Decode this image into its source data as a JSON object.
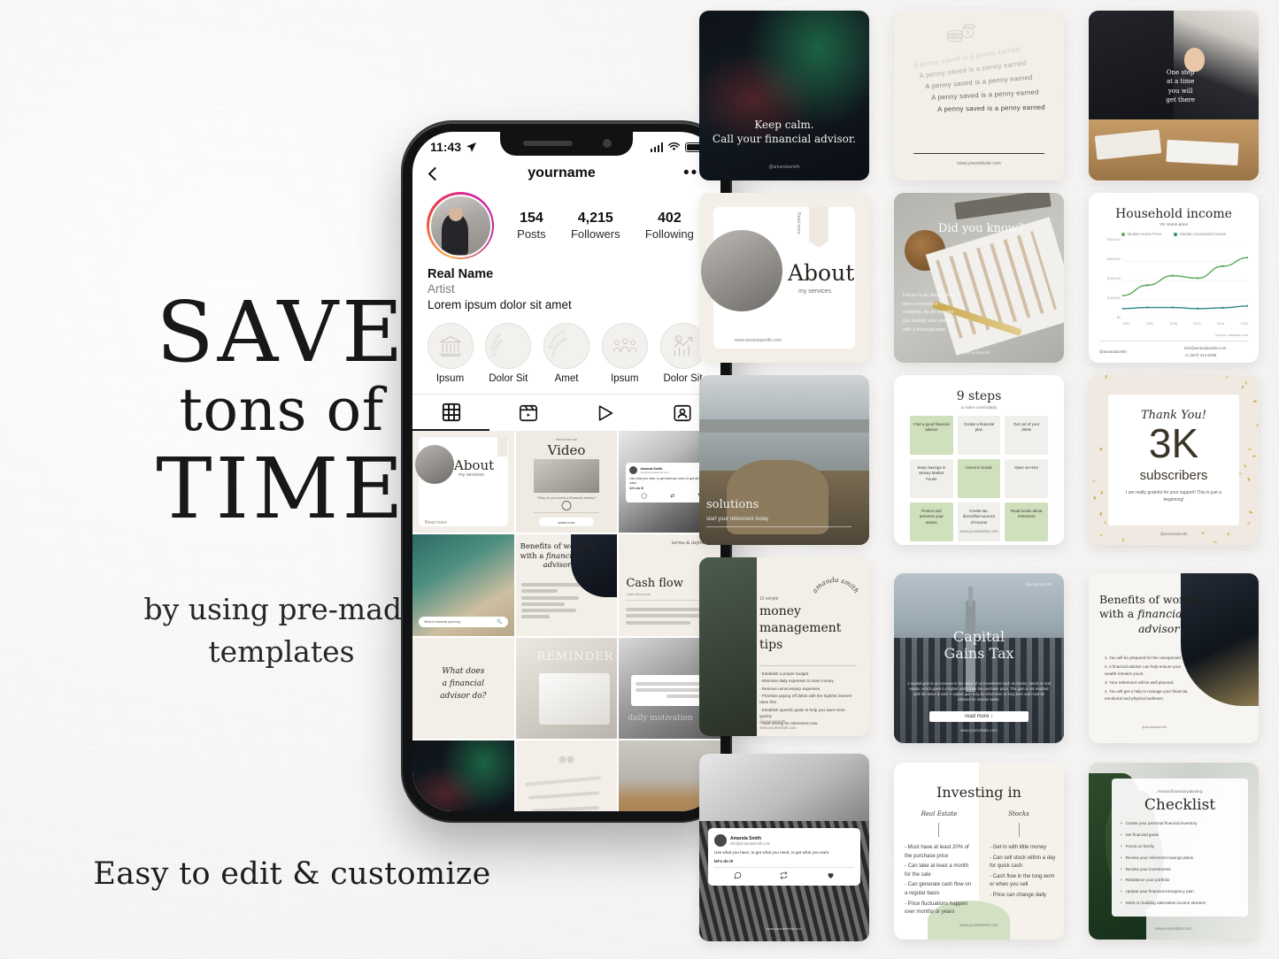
{
  "promo": {
    "headline_1": "SAVE",
    "headline_2": "tons of",
    "headline_3": "TIME",
    "subline": "by using pre-made templates",
    "footer_line": "Easy to edit & customize"
  },
  "phone": {
    "status": {
      "time": "11:43",
      "location_icon": "location-arrow-icon",
      "signal_icon": "cellular-signal-icon",
      "wifi_icon": "wifi-icon",
      "battery_icon": "battery-icon"
    },
    "header": {
      "back_icon": "chevron-left-icon",
      "username": "yourname",
      "more_icon": "ellipsis-icon"
    },
    "stats": [
      {
        "value": "154",
        "label": "Posts"
      },
      {
        "value": "4,215",
        "label": "Followers"
      },
      {
        "value": "402",
        "label": "Following"
      }
    ],
    "bio": {
      "real_name": "Real Name",
      "category": "Artist",
      "text": "Lorem ipsum dolor sit amet"
    },
    "highlights": [
      {
        "label": "Ipsum",
        "icon": "bank-building-icon",
        "arc_text": ""
      },
      {
        "label": "Dolor Sit",
        "icon": "arc-text-icon",
        "arc_text": "Crypto"
      },
      {
        "label": "Amet",
        "icon": "arc-text-icon",
        "arc_text": "financial freedom"
      },
      {
        "label": "Ipsum",
        "icon": "people-group-icon",
        "arc_text": ""
      },
      {
        "label": "Dolor Sit",
        "icon": "growth-chart-icon",
        "arc_text": ""
      }
    ],
    "tabs": [
      {
        "name": "grid",
        "icon": "grid-icon",
        "active": true
      },
      {
        "name": "reels",
        "icon": "reels-icon",
        "active": false
      },
      {
        "name": "video",
        "icon": "play-icon",
        "active": false
      },
      {
        "name": "tagged",
        "icon": "tagged-person-icon",
        "active": false
      }
    ],
    "grid_posts": [
      {
        "id": "p1",
        "kind": "about",
        "title": "About",
        "subtitle": "my services",
        "tag": "Read more"
      },
      {
        "id": "p2",
        "kind": "video",
        "eyebrow": "New from the",
        "title": "Video",
        "caption": "\"Why do you need a financial advisor\"",
        "button": "watch now"
      },
      {
        "id": "p3",
        "kind": "quote-card",
        "author": "Amanda Smith",
        "email": "info@amandasmith.com",
        "quote": "Use what you have, to get what you need, to get what you want.",
        "handle": "let's do it!"
      },
      {
        "id": "p4",
        "kind": "money-photo",
        "search_text": "What is financial planning"
      },
      {
        "id": "p5",
        "kind": "benefits",
        "title_1": "Benefits of working",
        "title_2": "with a",
        "title_3": "financial",
        "title_4": "advisor"
      },
      {
        "id": "p6",
        "kind": "cashflow",
        "eyebrow": "terms & definitions",
        "title": "Cash flow",
        "subtitle": "cash flow noun"
      },
      {
        "id": "p7",
        "kind": "question",
        "line_1": "What does",
        "line_2": "a financial",
        "line_3": "advisor do?"
      },
      {
        "id": "p8",
        "kind": "laptop-photo",
        "overlay": "REMINDER"
      },
      {
        "id": "p9",
        "kind": "quote-photo",
        "footer": "daily motivation"
      },
      {
        "id": "p10",
        "kind": "trading-photo"
      },
      {
        "id": "p11",
        "kind": "penny-swirl"
      },
      {
        "id": "p12",
        "kind": "meeting-photo"
      }
    ]
  },
  "templates": [
    {
      "id": "t1",
      "name": "keep-calm-trading-card",
      "line_1": "Keep calm.",
      "line_2": "Call your financial advisor.",
      "watermark": "@amandasmith"
    },
    {
      "id": "t2",
      "name": "penny-saved-card",
      "repeated_quote": "A penny saved is a penny earned",
      "repeat_count": 5,
      "icon": "coins-stack-icon",
      "website": "www.yourwebsite.com"
    },
    {
      "id": "t3",
      "name": "advisor-meeting-photo-card",
      "overlay_text": "One step at a time you will get there"
    },
    {
      "id": "t4",
      "name": "about-my-services-card",
      "title": "About",
      "subtitle": "my services",
      "side_tab": "Read more",
      "website": "www.amandasmith.com"
    },
    {
      "id": "t5",
      "name": "did-you-know-card",
      "title": "Did you know?",
      "body": "Future is an illusion that does not exist in certainty. As an investor you design your present with a financial plan.",
      "watermark": "@amandasmith"
    },
    {
      "id": "t6",
      "name": "household-income-chart-card",
      "title": "Household income",
      "subtitle": "VS Home price",
      "source_note": "Source: website.com",
      "footer_handle": "@amandasmith",
      "footer_email": "info@amandasmith.com",
      "footer_phone": "+1 (547) 314-8488",
      "chart_data": {
        "type": "line",
        "title": "Household income",
        "subtitle": "VS Home price",
        "xlabel": "",
        "ylabel": "",
        "x": [
          "1992",
          "2000",
          "2008",
          "2012",
          "2018",
          "2020"
        ],
        "ylim": [
          0,
          400000
        ],
        "yticks": [
          "$0",
          "$100,000",
          "$200,000",
          "$300,000",
          "$400,000"
        ],
        "grid": true,
        "legend_position": "top",
        "series": [
          {
            "name": "Median Home Price",
            "color": "#5aa85a",
            "values": [
              120000,
              175000,
              225000,
              212000,
              275000,
              320000
            ]
          },
          {
            "name": "Median Household Income",
            "color": "#2b8a7e",
            "values": [
              52000,
              58000,
              58000,
              52000,
              56000,
              66000
            ]
          }
        ]
      }
    },
    {
      "id": "t7",
      "name": "retirement-bridge-photo-card",
      "title": "solutions",
      "subtitle": "start your retirement today"
    },
    {
      "id": "t8",
      "name": "nine-steps-card",
      "title": "9 steps",
      "subtitle": "to retire comfortably",
      "website": "www.yourwebsite.com",
      "steps": [
        {
          "text": "Find a good financial adviser",
          "highlight": true
        },
        {
          "text": "Create a financial plan",
          "highlight": false
        },
        {
          "text": "Get out of your debts",
          "highlight": false
        },
        {
          "text": "Keep Savings in Money Market Funds",
          "highlight": false
        },
        {
          "text": "Invest in bonds",
          "highlight": true
        },
        {
          "text": "Open an HSA",
          "highlight": false
        },
        {
          "text": "Protect and preserve your assets",
          "highlight": true
        },
        {
          "text": "Create tax-diversified sources of income",
          "highlight": false
        },
        {
          "text": "Read books about retirement",
          "highlight": true
        }
      ]
    },
    {
      "id": "t9",
      "name": "thank-you-subscribers-card",
      "eyebrow": "Thank You!",
      "count": "3K",
      "count_label": "subscribers",
      "body": "I am really grateful for your support! This is just a beginning!",
      "watermark": "@amandasmith",
      "accent_color": "#c9a227"
    },
    {
      "id": "t10",
      "name": "money-management-tips-card",
      "eyebrow": "10 simple",
      "title_1": "money",
      "title_2": "management",
      "title_3": "tips",
      "arc_text": "amanda smith",
      "tips": [
        "Establish a proper budget",
        "Minimize daily expenses to save money",
        "Remove unnecessary expenses",
        "Prioritize paying off debts with the highest interest rates first",
        "Establish specific goals to help you save more quickly",
        "Start saving for retirement now"
      ],
      "handle": "@amandasmith",
      "website": "www.yourwebsite.com"
    },
    {
      "id": "t11",
      "name": "capital-gains-tax-card",
      "title_1": "Capital",
      "title_2": "Gains Tax",
      "body": "A capital gain is an increase in the value of an investment such as stocks, bonds or real estate, which gives it a higher worth than the purchase price. The gain is not realized until the asset is sold. A capital gain may be short term or long term and must be claimed on income taxes.",
      "button": "read more ↓",
      "website": "www.yourwebsite.com",
      "watermark": "@amandasmith"
    },
    {
      "id": "t12",
      "name": "benefits-financial-advisor-card",
      "title_1": "Benefits of working",
      "title_2": "with a",
      "title_3": "financial",
      "title_4": "advisor",
      "watermark": "@amandasmith",
      "items": [
        "You will be prepared for the unexpected.",
        "A financial advisor can help ensure your wealth remains yours.",
        "Your retirement will be well planned.",
        "You will get a help to manage your financial, emotional and physical wellness."
      ]
    },
    {
      "id": "t13",
      "name": "quote-skyscraper-card",
      "author": "Amanda Smith",
      "email": "info@amandasmith.com",
      "quote": "Use what you have, to get what you need, to get what you want.",
      "handle": "let's do it!",
      "website": "www.yourwebsite.com",
      "actions": [
        "comment-icon",
        "repost-icon",
        "heart-icon"
      ]
    },
    {
      "id": "t14",
      "name": "investing-in-comparison-card",
      "title": "Investing in",
      "col_1_head": "Real Estate",
      "col_2_head": "Stocks",
      "col_1_items": [
        "- Must have at least 20% of the purchase price",
        "- Can take at least a month for the sale",
        "- Can generate cash flow on a regular basis",
        "- Price fluctuations happen over months or years"
      ],
      "col_2_items": [
        "- Get in with little money",
        "- Can sell stock within a day for quick cash",
        "- Cash flow in the long-term or when you sell",
        "- Price can change daily"
      ],
      "website": "www.yourwebsite.com"
    },
    {
      "id": "t15",
      "name": "annual-checklist-card",
      "eyebrow": "Annual financial planning",
      "title": "Checklist",
      "website": "www.yourwebsite.com",
      "items": [
        "Create your personal financial inventory",
        "Set financial goals",
        "Focus on family",
        "Review your retirement savings plans",
        "Review your investments",
        "Rebalance your portfolio",
        "Update your financial emergency plan",
        "Work on building alternative income streams"
      ]
    }
  ]
}
